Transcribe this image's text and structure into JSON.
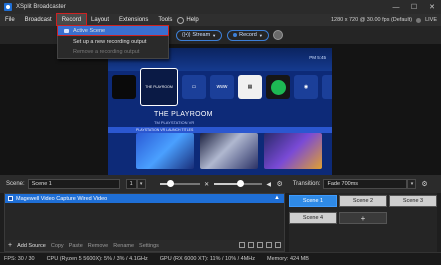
{
  "window": {
    "title": "XSplit Broadcaster",
    "controls": [
      "—",
      "☐",
      "✕"
    ]
  },
  "menu": {
    "items": [
      "File",
      "Broadcast",
      "Record",
      "Layout",
      "Extensions",
      "Tools",
      "Help"
    ],
    "status": "1280 x 720 @ 30.00 fps (Default)",
    "live_label": "LIVE"
  },
  "toolbar": {
    "stream_label": "Stream",
    "record_label": "Record"
  },
  "record_menu": {
    "items": [
      {
        "label": "Active Scene",
        "state": "selected"
      },
      {
        "label": "Set up a new recording output",
        "state": "normal"
      },
      {
        "label": "Remove a recording output",
        "state": "disabled"
      }
    ]
  },
  "preview": {
    "title": "THE PLAYROOM",
    "tile_label": "THE PLAYROOM",
    "sub": "TM PLAYSTATION VR",
    "band": "PLAYSTATION VR LAUNCH TITLES",
    "clock": "PM 5:45"
  },
  "scene_bar": {
    "scene_label": "Scene:",
    "scene_name": "Scene 1",
    "layer_value": "1",
    "transition_label": "Transition:",
    "transition_value": "Fade 700ms"
  },
  "audio": {
    "mic_level": 0.28,
    "speaker_level": 0.55
  },
  "sources": {
    "items": [
      {
        "name": "Magewell Video Capture Wired Video",
        "checked": true
      }
    ],
    "footer": {
      "add": "Add Source",
      "copy": "Copy",
      "paste": "Paste",
      "remove": "Remove",
      "rename": "Rename",
      "settings": "Settings"
    }
  },
  "scenes": {
    "buttons": [
      "Scene 1",
      "Scene 2",
      "Scene 3",
      "Scene 4"
    ],
    "add_label": "+"
  },
  "status_bar": {
    "fps": "FPS:  30 / 30",
    "cpu": "CPU (Ryzen 5 5600X):  5% / 3% / 4.1GHz",
    "gpu": "GPU (RX 6000 XT):  11% / 10% / 4MHz",
    "memory": "Memory:  424 MB"
  },
  "colors": {
    "accent": "#1f6fd6",
    "highlight_outline": "#cc2222",
    "background": "#1e1e1e"
  }
}
